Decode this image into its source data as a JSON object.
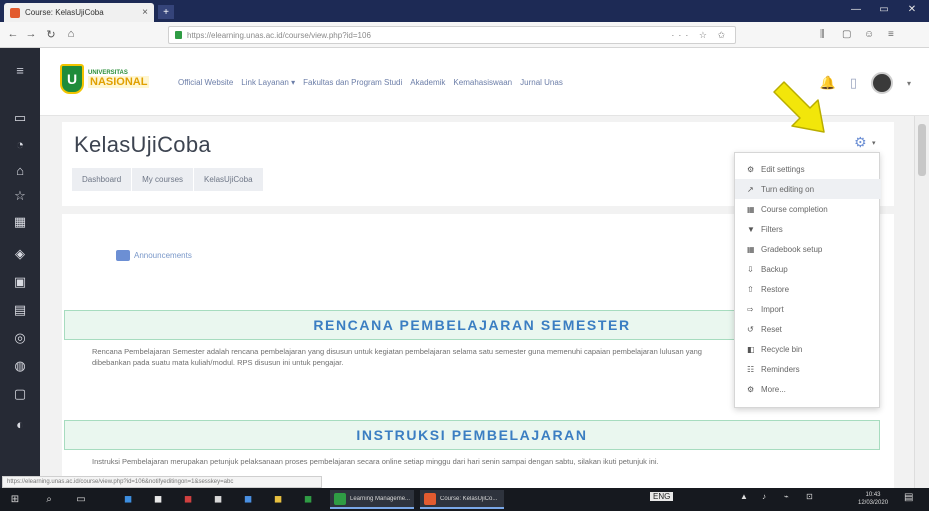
{
  "browser": {
    "tab_title": "Course: KelasUjiCoba",
    "tab_close": "×",
    "new_tab": "+",
    "window_buttons": [
      "—",
      "▭",
      "✕"
    ],
    "nav_buttons": [
      "←",
      "→",
      "↻",
      "⌂"
    ],
    "url": "https://elearning.unas.ac.id/course/view.php?id=106",
    "url_icons": "··· ☆ ✩",
    "toolbar_icons": [
      "⫼",
      "▢",
      "☺",
      "≡"
    ]
  },
  "drawer": {
    "icons": [
      "hamburger-icon",
      "dashboard-icon",
      "calendar-icon",
      "home-icon",
      "star-icon",
      "folder-icon",
      "graduation-icon",
      "archive-icon",
      "grid-icon",
      "badge-icon",
      "book-icon",
      "chat-icon",
      "settings-icon"
    ],
    "glyphs": [
      "≡",
      "▭",
      "◔",
      "⌂",
      "☆",
      "▦",
      "◈",
      "▣",
      "▤",
      "◎",
      "◍",
      "▢",
      "◐"
    ]
  },
  "navbar": {
    "logo_line1": "UNIVERSITAS",
    "logo_line2": "NASIONAL",
    "logo_emblem": "U",
    "menu": [
      "Official Website",
      "Link Layanan ▾",
      "Fakultas dan Program Studi",
      "Akademik",
      "Kemahasiswaan",
      "Jurnal Unas"
    ],
    "bell_icon": "🔔",
    "message_icon": "▯",
    "avatar_caret": "▾"
  },
  "page": {
    "course_title": "KelasUjiCoba",
    "breadcrumbs": [
      "Dashboard",
      "My courses",
      "KelasUjiCoba"
    ],
    "announcements": "Announcements",
    "section1_title": "RENCANA PEMBELAJARAN SEMESTER",
    "section1_desc": "Rencana Pembelajaran Semester adalah rencana pembelajaran yang disusun untuk kegiatan pembelajaran selama satu semester guna memenuhi capaian pembelajaran lulusan yang dibebankan pada suatu mata kuliah/modul. RPS disusun ini untuk pengajar.",
    "section2_title": "INSTRUKSI PEMBELAJARAN",
    "section2_desc": "Instruksi Pembelajaran merupakan petunjuk pelaksanaan proses pembelajaran secara online setiap minggu dari hari senin sampai dengan sabtu, silakan ikuti petunjuk ini."
  },
  "settings": {
    "gear": "⚙",
    "caret": "▾",
    "menu": [
      {
        "icon": "⚙",
        "label": "Edit settings"
      },
      {
        "icon": "↗",
        "label": "Turn editing on"
      },
      {
        "icon": "▦",
        "label": "Course completion"
      },
      {
        "icon": "▼",
        "label": "Filters"
      },
      {
        "icon": "▦",
        "label": "Gradebook setup"
      },
      {
        "icon": "⇩",
        "label": "Backup"
      },
      {
        "icon": "⇧",
        "label": "Restore"
      },
      {
        "icon": "⇨",
        "label": "Import"
      },
      {
        "icon": "↺",
        "label": "Reset"
      },
      {
        "icon": "◧",
        "label": "Recycle bin"
      },
      {
        "icon": "☷",
        "label": "Reminders"
      },
      {
        "icon": "⚙",
        "label": "More..."
      }
    ],
    "active_index": 1
  },
  "statusbar": {
    "text": "https://elearning.unas.ac.id/course/view.php?id=106&notifyeditingon=1&sesskey=abc"
  },
  "taskbar": {
    "start": "⊞",
    "search": "⌕",
    "taskview": "▭",
    "pinned": [
      "◼",
      "◼",
      "◼",
      "◼",
      "◼",
      "◼",
      "◼"
    ],
    "app1": "Learning Manageme...",
    "app2": "Course: KelasUjiCo...",
    "tray_items": [
      "ENG",
      "▲",
      "♪",
      "⌁",
      "⊡"
    ],
    "time": "10:43",
    "date": "12/03/2020",
    "notifications": "▤"
  },
  "colors": {
    "brand_green": "#1f8c3a",
    "link_blue": "#3b7ec2",
    "arrow_yellow": "#f2e60a"
  }
}
